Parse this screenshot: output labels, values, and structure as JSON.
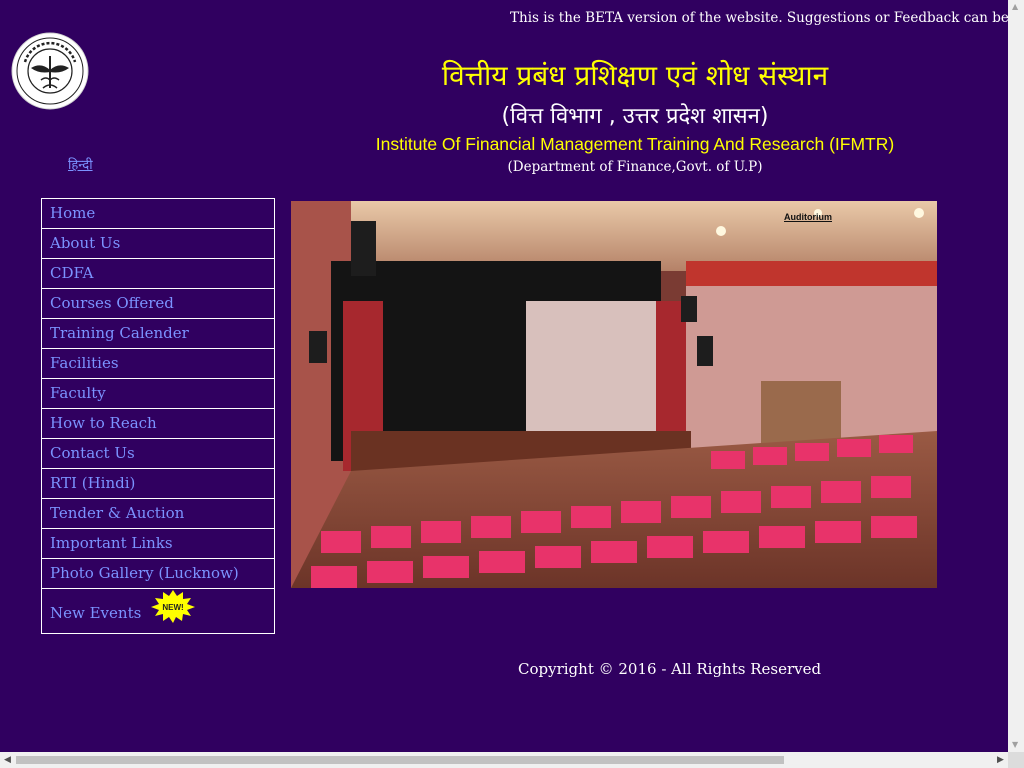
{
  "banner": {
    "text": "This is the BETA version of the website. Suggestions or Feedback can be sent on i"
  },
  "emblem": {
    "icon": "up-govt-emblem-icon"
  },
  "lang_link": "हिन्दी",
  "header": {
    "title_hi": "वित्तीय प्रबंध प्रशिक्षण एवं शोध संस्थान",
    "subtitle_hi": "(वित्त विभाग , उत्तर प्रदेश शासन)",
    "title_en": "Institute Of Financial Management Training And Research (IFMTR)",
    "subtitle_en": "(Department of Finance,Govt. of U.P)"
  },
  "nav": {
    "items": [
      {
        "label": "Home"
      },
      {
        "label": "About Us"
      },
      {
        "label": "CDFA"
      },
      {
        "label": "Courses Offered"
      },
      {
        "label": "Training Calender"
      },
      {
        "label": "Facilities"
      },
      {
        "label": "Faculty"
      },
      {
        "label": "How to Reach"
      },
      {
        "label": "Contact Us"
      },
      {
        "label": "RTI (Hindi)"
      },
      {
        "label": "Tender & Auction"
      },
      {
        "label": "Important Links"
      },
      {
        "label": "Photo Gallery (Lucknow)"
      },
      {
        "label": "New Events",
        "badge": "NEW!"
      }
    ]
  },
  "slideshow": {
    "caption": "Auditorium"
  },
  "footer": {
    "copyright": "Copyright © 2016 - All Rights Reserved"
  },
  "colors": {
    "page_background": "#300060",
    "heading_yellow": "#ffff00",
    "link_blue": "#7b93ff",
    "text_white": "#ffffff"
  }
}
